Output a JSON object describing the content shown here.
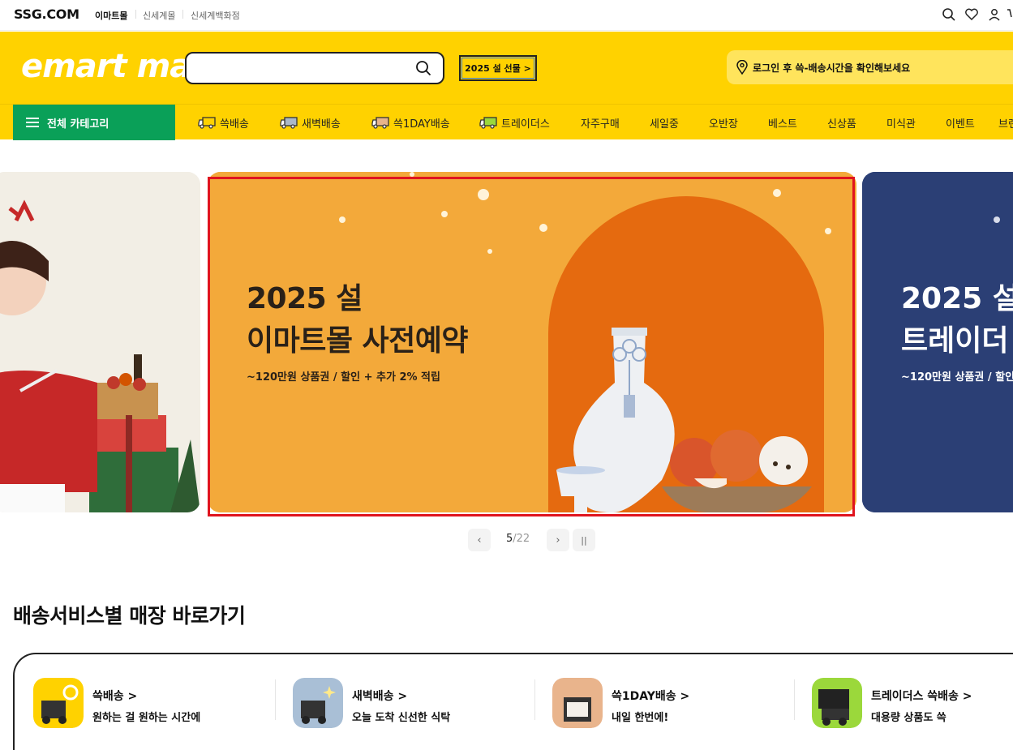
{
  "topbar": {
    "brand": "SSG.COM",
    "malls": [
      "이마트몰",
      "신세계몰",
      "신세계백화점"
    ],
    "icons": [
      "search-icon",
      "heart-icon",
      "user-icon",
      "cart-icon"
    ]
  },
  "header": {
    "logo": "emart mall",
    "search": {
      "value": "",
      "placeholder": ""
    },
    "promo_chip": "2025 설 선물 >",
    "delivery_info": "로그인 후 쓱-배송시간을 확인해보세요"
  },
  "nav": {
    "category_button": "전체 카테고리",
    "items": [
      {
        "label": "쓱배송",
        "icon": "truck-icon"
      },
      {
        "label": "새벽배송",
        "icon": "truck-icon"
      },
      {
        "label": "쓱1DAY배송",
        "icon": "truck-icon"
      },
      {
        "label": "트레이더스",
        "icon": "truck-icon"
      },
      {
        "label": "자주구매"
      },
      {
        "label": "세일중"
      },
      {
        "label": "오반장"
      },
      {
        "label": "베스트"
      },
      {
        "label": "신상품"
      },
      {
        "label": "미식관"
      },
      {
        "label": "이벤트"
      },
      {
        "label": "브랜"
      }
    ]
  },
  "carousel": {
    "center": {
      "title_line1": "2025 설",
      "title_line2": "이마트몰 사전예약",
      "subtitle": "~120만원 상품권 / 할인 + 추가 2% 적립"
    },
    "right": {
      "title_line1": "2025 설",
      "title_line2": "트레이더",
      "subtitle": "~120만원 상품권 / 할인"
    },
    "pager": {
      "current": "5",
      "total": "/22",
      "prev": "‹",
      "next": "›",
      "pause": "||"
    }
  },
  "section": {
    "title": "배송서비스별 매장 바로가기",
    "services": [
      {
        "name": "쓱배송 >",
        "desc": "원하는 걸 원하는 시간에"
      },
      {
        "name": "새벽배송 >",
        "desc": "오늘 도착 신선한 식탁"
      },
      {
        "name": "쓱1DAY배송 >",
        "desc": "내일 한번에!"
      },
      {
        "name": "트레이더스 쓱배송 >",
        "desc": "대용량 상품도 쓱"
      }
    ]
  },
  "colors": {
    "brand_yellow": "#ffd200",
    "category_green": "#0aa058",
    "highlight_red": "#e0141e",
    "banner_orange": "#f3a93a",
    "banner_navy": "#2b3f75"
  }
}
